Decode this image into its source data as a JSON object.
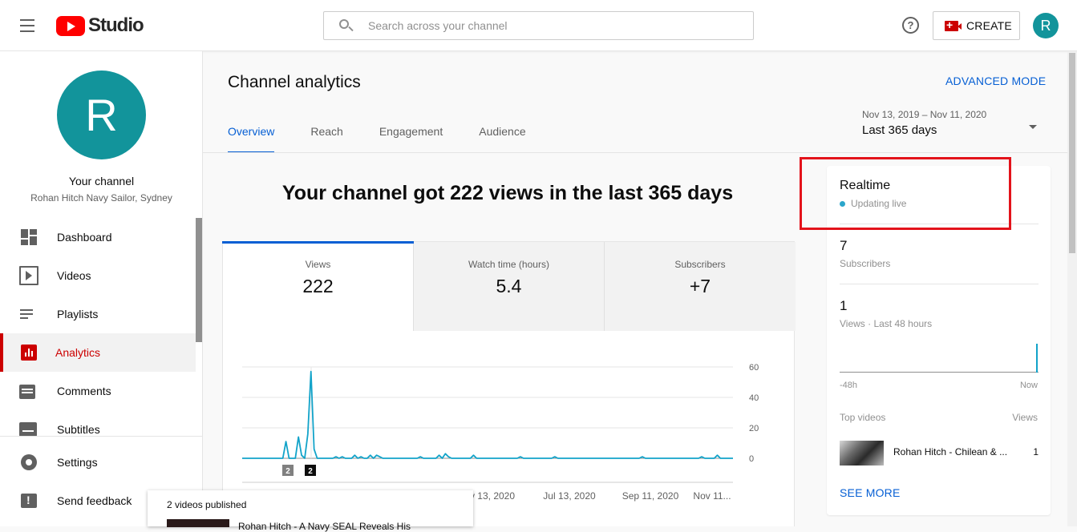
{
  "header": {
    "logo_text": "Studio",
    "search_placeholder": "Search across your channel",
    "help_icon": "?",
    "create_label": "CREATE",
    "avatar_letter": "R"
  },
  "sidebar": {
    "avatar_letter": "R",
    "channel_title": "Your channel",
    "channel_subtitle": "Rohan Hitch Navy Sailor, Sydney",
    "items": [
      {
        "label": "Dashboard",
        "icon": "dashboard-icon"
      },
      {
        "label": "Videos",
        "icon": "videos-icon"
      },
      {
        "label": "Playlists",
        "icon": "playlists-icon"
      },
      {
        "label": "Analytics",
        "icon": "analytics-icon",
        "active": true
      },
      {
        "label": "Comments",
        "icon": "comments-icon"
      },
      {
        "label": "Subtitles",
        "icon": "subtitles-icon"
      }
    ],
    "bottom_items": [
      {
        "label": "Settings",
        "icon": "settings-icon"
      },
      {
        "label": "Send feedback",
        "icon": "feedback-icon"
      }
    ]
  },
  "main": {
    "title": "Channel analytics",
    "advanced_mode": "ADVANCED MODE",
    "date_range": "Nov 13, 2019 – Nov 11, 2020",
    "date_label": "Last 365 days",
    "tabs": [
      {
        "label": "Overview",
        "active": true
      },
      {
        "label": "Reach"
      },
      {
        "label": "Engagement"
      },
      {
        "label": "Audience"
      }
    ],
    "headline": "Your channel got 222 views in the last 365 days",
    "metrics": [
      {
        "label": "Views",
        "value": "222",
        "active": true
      },
      {
        "label": "Watch time (hours)",
        "value": "5.4"
      },
      {
        "label": "Subscribers",
        "value": "+7"
      }
    ]
  },
  "chart_data": {
    "type": "line",
    "title": "",
    "xlabel": "",
    "ylabel": "",
    "ylim": [
      0,
      60
    ],
    "yticks": [
      "60",
      "40",
      "20",
      "0"
    ],
    "ytick_values": [
      60,
      40,
      20,
      0
    ],
    "xticks": [
      "y 13, 2020",
      "Jul 13, 2020",
      "Sep 11, 2020",
      "Nov 11..."
    ],
    "x_markers": [
      "2",
      "2"
    ],
    "series": [
      {
        "color": "#12a3c9",
        "values": [
          0,
          0,
          0,
          0,
          0,
          0,
          0,
          0,
          0,
          0,
          0,
          0,
          0,
          0,
          11,
          0,
          0,
          0,
          14,
          2,
          0,
          16,
          57,
          6,
          0,
          0,
          0,
          0,
          0,
          0,
          1,
          0,
          1,
          0,
          0,
          0,
          2,
          0,
          1,
          0,
          0,
          2,
          0,
          2,
          1,
          0,
          0,
          0,
          0,
          0,
          0,
          0,
          0,
          0,
          0,
          0,
          0,
          1,
          0,
          0,
          0,
          0,
          0,
          2,
          0,
          3,
          1,
          0,
          0,
          0,
          0,
          0,
          0,
          0,
          2,
          0,
          0,
          0,
          0,
          0,
          0,
          0,
          0,
          0,
          0,
          0,
          0,
          0,
          0,
          1,
          0,
          0,
          0,
          0,
          0,
          0,
          0,
          0,
          0,
          0,
          1,
          0,
          0,
          0,
          0,
          0,
          0,
          0,
          0,
          0,
          0,
          0,
          0,
          0,
          0,
          0,
          0,
          0,
          0,
          0,
          0,
          0,
          0,
          0,
          0,
          0,
          0,
          0,
          1,
          0,
          0,
          0,
          0,
          0,
          0,
          0,
          0,
          0,
          0,
          0,
          0,
          0,
          0,
          0,
          0,
          0,
          0,
          1,
          0,
          0,
          0,
          0,
          2,
          0,
          0,
          0,
          0,
          0
        ]
      }
    ]
  },
  "tooltip": {
    "title": "2 videos published",
    "video_title": "Rohan Hitch - A Navy SEAL Reveals His"
  },
  "realtime": {
    "title": "Realtime",
    "status": "Updating live",
    "subscribers_value": "7",
    "subscribers_label": "Subscribers",
    "views_value": "1",
    "views_label": "Views · Last 48 hours",
    "axis_left": "-48h",
    "axis_right": "Now",
    "spark_values": [
      0,
      0,
      0,
      0,
      0,
      0,
      0,
      0,
      0,
      0,
      0,
      0,
      0,
      0,
      0,
      0,
      0,
      0,
      0,
      0,
      0,
      0,
      0,
      0,
      0,
      0,
      0,
      0,
      0,
      0,
      0,
      0,
      0,
      0,
      0,
      0,
      0,
      0,
      0,
      0,
      0,
      0,
      0,
      0,
      0,
      0,
      0,
      1
    ],
    "top_videos_label": "Top videos",
    "views_col_label": "Views",
    "top_video_title": "Rohan Hitch - Chilean & ...",
    "top_video_views": "1",
    "see_more": "SEE MORE"
  },
  "colors": {
    "accent_red": "#cc0000",
    "link_blue": "#065fd4",
    "chart_line": "#12a3c9",
    "avatar": "#12949b",
    "highlight": "#e3131b"
  }
}
